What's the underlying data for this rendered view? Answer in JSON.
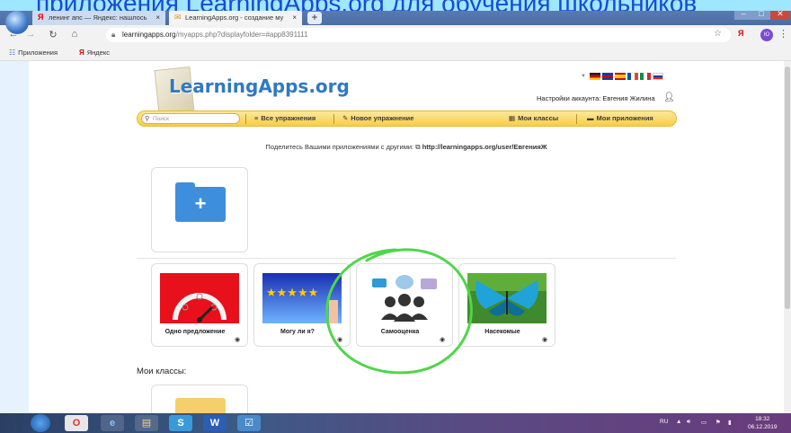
{
  "banner_text": "приложения LearningApps.org для обучения школьников",
  "browser": {
    "tabs": [
      {
        "label": "ленинг апс — Яндекс: нашлось",
        "icon": "Я",
        "close": "×"
      },
      {
        "label": "LearningApps.org - создание му",
        "icon": "✉",
        "close": "×"
      }
    ],
    "new_tab": "+",
    "window_controls": {
      "minimize": "–",
      "maximize": "□",
      "close": "✕"
    },
    "nav": {
      "back": "←",
      "forward": "→",
      "reload": "↻",
      "home": "⌂"
    },
    "url_host": "learningapps.org",
    "url_path": "/myapps.php?displayfolder=#app8391111",
    "profile": "Ю",
    "bookmarks": [
      {
        "icon": "☷",
        "label": "Приложения"
      },
      {
        "icon": "Я",
        "label": "Яндекс"
      }
    ]
  },
  "site": {
    "logo": "LearningApps.org",
    "account": "Настройки аккаунта: Евгения Жилина",
    "search_placeholder": "Поиск",
    "nav": [
      {
        "icon": "≡",
        "label": "Все упражнения"
      },
      {
        "icon": "✎",
        "label": "Новое упражнение"
      },
      {
        "icon": "▦",
        "label": "Мои классы"
      },
      {
        "icon": "▬",
        "label": "Мои приложения"
      }
    ],
    "share_text": "Поделитесь Вашими приложениями с другими:",
    "share_icon": "⧉",
    "share_url": "http://learningapps.org/user/ЕвгенияЖ",
    "new_folder_plus": "+",
    "apps": [
      {
        "title": "Одно предложение",
        "eye": "◉"
      },
      {
        "title": "Могу ли я?",
        "eye": "◉"
      },
      {
        "title": "Самооценка",
        "eye": "◉"
      },
      {
        "title": "Насекомые",
        "eye": "◉"
      }
    ],
    "classes_heading": "Мои классы:"
  },
  "taskbar": {
    "apps": [
      "O",
      "e",
      "▤",
      "S",
      "W",
      "☑"
    ],
    "lang": "RU",
    "time": "18:32",
    "date": "06.12.2019"
  }
}
